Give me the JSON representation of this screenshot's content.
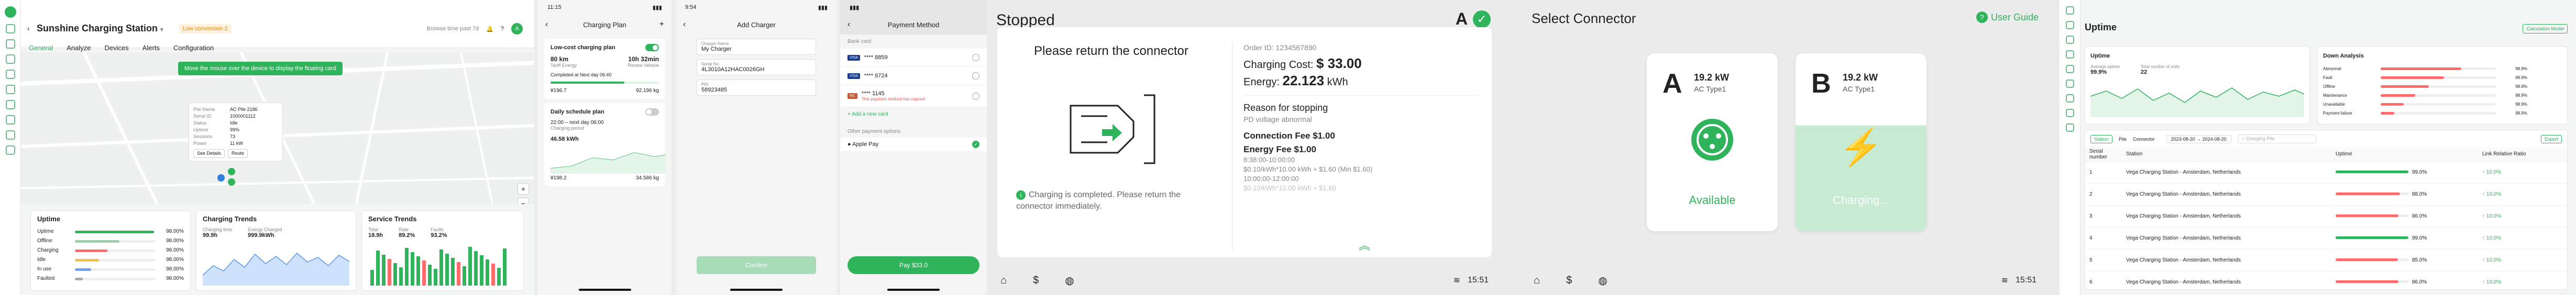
{
  "dashboard": {
    "title": "Sunshine Charging Station",
    "badge": "Low conversion 2",
    "header_right": {
      "range": "Browse time past 7d",
      "user_initial": "A"
    },
    "tabs": [
      "General",
      "Analyze",
      "Devices",
      "Alerts",
      "Configuration"
    ],
    "map_tip": "Move the mouse over the device to display the floating card",
    "popup": {
      "rows": [
        [
          "Pile Name",
          "AC Pile 2186"
        ],
        [
          "Serial ID",
          "1000001112"
        ],
        [
          "Status",
          "Idle"
        ],
        [
          "Uptime",
          "99%"
        ],
        [
          "Sessions",
          "73"
        ],
        [
          "Power",
          "11 kW"
        ]
      ],
      "btn_details": "See Details",
      "btn_route": "Route"
    },
    "map_zoom": [
      "+",
      "−"
    ],
    "uptime": {
      "title": "Uptime",
      "rows": [
        {
          "label": "Uptime",
          "value": "98.00%",
          "pct": 0.98,
          "color": "#2fb35b"
        },
        {
          "label": "Offline",
          "value": "98.00%",
          "pct": 0.55,
          "color": "#9ad1ad"
        },
        {
          "label": "Charging",
          "value": "98.00%",
          "pct": 0.4,
          "color": "#ff6b6b"
        },
        {
          "label": "Idle",
          "value": "98.00%",
          "pct": 0.3,
          "color": "#f3c04f"
        },
        {
          "label": "In use",
          "value": "98.00%",
          "pct": 0.2,
          "color": "#6f9ef5"
        },
        {
          "label": "Faulted",
          "value": "98.00%",
          "pct": 0.1,
          "color": "#aaa"
        }
      ]
    },
    "charging_trends": {
      "title": "Charging Trends",
      "stats": [
        {
          "label": "Charging time",
          "value": "99.9h"
        },
        {
          "label": "Energy Charged",
          "value": "999.9kWh"
        }
      ]
    },
    "service_trends": {
      "title": "Service Trends",
      "stats": [
        {
          "label": "Total",
          "value": "18.9h"
        },
        {
          "label": "Rate",
          "value": "89.2%"
        },
        {
          "label": "Faults",
          "value": "93.2%"
        }
      ]
    }
  },
  "charging_plan": {
    "status_time": "11:15",
    "title": "Charging Plan",
    "plan1": {
      "title": "Low-cost charging plan",
      "limit": "80 km",
      "time": "10h 32min",
      "mode_a": "Tariff Energy",
      "mode_b": "Renew Vehicle",
      "completed": "Completed at Next day 06:40",
      "values": [
        "¥196.7",
        "92.196 kg"
      ]
    },
    "plan2": {
      "title": "Daily schedule plan",
      "time": "22:00 – next day 06:00",
      "period": "Charging period",
      "energy": "46.58 kWh",
      "values": [
        "¥198.2",
        "34.586 kg"
      ]
    }
  },
  "add_charger": {
    "status_time": "9:54",
    "title": "Add Charger",
    "fields": [
      {
        "label": "Charger Name",
        "value": "My Charger"
      },
      {
        "label": "Serial No.",
        "value": "4L3010A12HAC0026GH"
      },
      {
        "label": "PIN",
        "value": "58923485"
      }
    ],
    "submit": "Confirm"
  },
  "payment": {
    "title": "Payment Method",
    "section_bank": "Bank card",
    "cards": [
      {
        "brand": "VISA",
        "number": "**** 8859",
        "color": "#1a3d8f",
        "selected": false
      },
      {
        "brand": "VISA",
        "number": "**** 9724",
        "color": "#1a3d8f",
        "selected": false
      },
      {
        "brand": "MC",
        "number": "**** 1145",
        "color": "#c45a32",
        "selected": false,
        "note": "This payment method has expired"
      }
    ],
    "add_card": "+ Add a new card",
    "section_other": "Other payment options",
    "other": [
      {
        "name": "Apple Pay",
        "selected": true
      }
    ],
    "pay_button": "Pay $33.0"
  },
  "stopped": {
    "header": "Stopped",
    "connector_letter": "A",
    "prompt": "Please return the connector",
    "notice": "Charging is completed. Please return the connector immediately.",
    "order_id": "Order ID: 1234567890",
    "cost_label": "Charging Cost:",
    "cost_value": "$ 33.00",
    "energy_label": "Energy:",
    "energy_value": "22.123",
    "energy_unit": "kWh",
    "reason_title": "Reason for stopping",
    "reason": "PD voltage abnormal",
    "connection_fee": "Connection Fee $1.00",
    "energy_fee": "Energy Fee $1.00",
    "energy_fee_lines": [
      "8:38:00-10:00:00",
      "$0.10/kWh*10.00 kWh + $1.60 (Min $1.60)",
      "10:00:00-12:00:00",
      "$0.10/kWh*10.00 kWh + $1.60"
    ],
    "time": "15:51"
  },
  "select_connector": {
    "header": "Select Connector",
    "guide": "User Guide",
    "connectors": [
      {
        "letter": "A",
        "power": "19.2 kW",
        "type": "AC Type1",
        "status": "Available"
      },
      {
        "letter": "B",
        "power": "19.2 kW",
        "type": "AC Type1",
        "status": "Charging..."
      }
    ],
    "time": "15:51"
  },
  "uptime_page": {
    "title": "Uptime",
    "calc_button": "Calculation Model",
    "uptime_card": {
      "title": "Uptime",
      "stats": [
        {
          "label": "Average uptime",
          "value": "99.9%"
        },
        {
          "label": "Total number of units",
          "value": "22"
        }
      ]
    },
    "down_card": {
      "title": "Down Analysis",
      "rows": [
        {
          "label": "Abnormal",
          "value": "98.9%",
          "pct": 0.7
        },
        {
          "label": "Fault",
          "value": "98.9%",
          "pct": 0.55
        },
        {
          "label": "Offline",
          "value": "98.9%",
          "pct": 0.42
        },
        {
          "label": "Maintenance",
          "value": "98.9%",
          "pct": 0.3
        },
        {
          "label": "Unavailable",
          "value": "98.9%",
          "pct": 0.2
        },
        {
          "label": "Payment failure",
          "value": "98.9%",
          "pct": 0.12
        }
      ]
    },
    "filters": {
      "tabs": [
        "Station",
        "Pile",
        "Connector"
      ],
      "range": "2023-08-20 → 2024-08-20",
      "search": "Charging Pile",
      "export": "Export"
    },
    "columns": [
      "Serial number",
      "Station",
      "Uptime",
      "Link Relative Ratio"
    ],
    "rows": [
      {
        "n": "1",
        "station": "Vega Charging Station - Amsterdam, Netherlands",
        "uptime": "99.0%",
        "pct": 0.99,
        "ratio": "↑ 10.0%"
      },
      {
        "n": "2",
        "station": "Vega Charging Station - Amsterdam, Netherlands",
        "uptime": "88.0%",
        "pct": 0.88,
        "ratio": "↑ 10.0%"
      },
      {
        "n": "3",
        "station": "Vega Charging Station - Amsterdam, Netherlands",
        "uptime": "86.0%",
        "pct": 0.86,
        "ratio": "↑ 10.0%"
      },
      {
        "n": "4",
        "station": "Vega Charging Station - Amsterdam, Netherlands",
        "uptime": "99.0%",
        "pct": 0.99,
        "ratio": "↑ 10.0%"
      },
      {
        "n": "5",
        "station": "Vega Charging Station - Amsterdam, Netherlands",
        "uptime": "85.0%",
        "pct": 0.85,
        "ratio": "↑ 10.0%"
      },
      {
        "n": "6",
        "station": "Vega Charging Station - Amsterdam, Netherlands",
        "uptime": "86.0%",
        "pct": 0.86,
        "ratio": "↑ 10.0%"
      }
    ]
  }
}
